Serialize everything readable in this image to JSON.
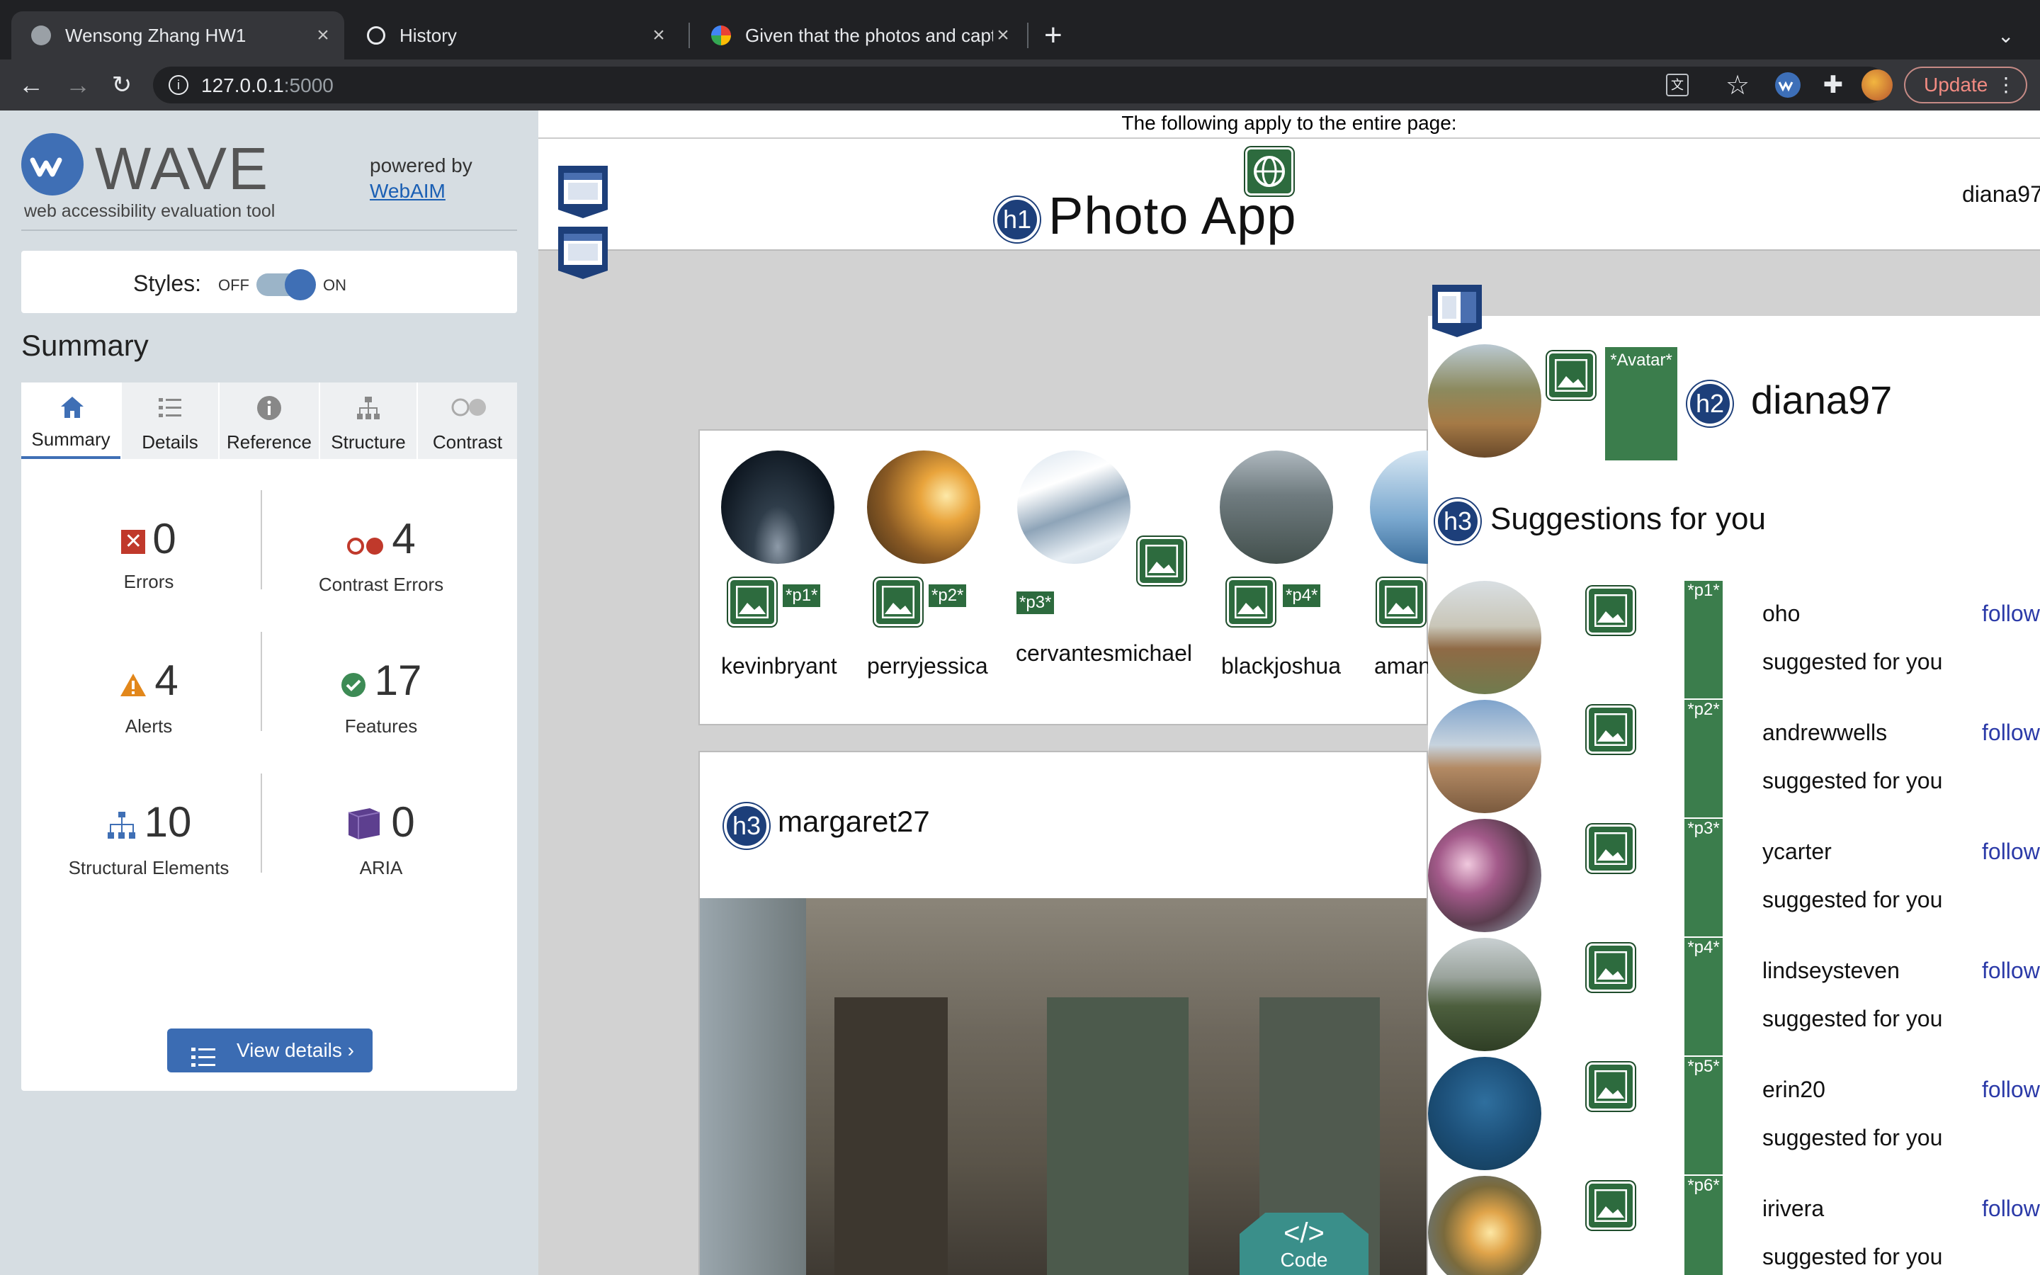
{
  "browser": {
    "tabs": [
      {
        "title": "Wensong Zhang HW1",
        "active": true,
        "icon": "globe-icon"
      },
      {
        "title": "History",
        "active": false,
        "icon": "history-icon"
      },
      {
        "title": "Given that the photos and capt",
        "active": false,
        "icon": "google-icon"
      }
    ],
    "new_tab": "+",
    "address": {
      "host": "127.0.0.1",
      "port": ":5000"
    },
    "update_label": "Update"
  },
  "wave": {
    "logo_text": "WAVE",
    "tagline": "web accessibility evaluation tool",
    "powered_by": "powered by",
    "webaim_link": "WebAIM",
    "styles_label": "Styles:",
    "toggle_off": "OFF",
    "toggle_on": "ON",
    "summary_heading": "Summary",
    "tabs": [
      {
        "label": "Summary",
        "icon": "home-icon",
        "active": true
      },
      {
        "label": "Details",
        "icon": "list-icon",
        "active": false
      },
      {
        "label": "Reference",
        "icon": "info-icon",
        "active": false
      },
      {
        "label": "Structure",
        "icon": "structure-icon",
        "active": false
      },
      {
        "label": "Contrast",
        "icon": "contrast-icon",
        "active": false
      }
    ],
    "stats": {
      "errors": {
        "value": "0",
        "label": "Errors"
      },
      "contrast_errors": {
        "value": "4",
        "label": "Contrast Errors"
      },
      "alerts": {
        "value": "4",
        "label": "Alerts"
      },
      "features": {
        "value": "17",
        "label": "Features"
      },
      "structural": {
        "value": "10",
        "label": "Structural Elements"
      },
      "aria": {
        "value": "0",
        "label": "ARIA"
      }
    },
    "view_details": "View details ›"
  },
  "page": {
    "notice": "The following apply to the entire page:",
    "app_title": "Photo App",
    "header_user": "diana97",
    "h1": "h1",
    "h2": "h2",
    "h3": "h3",
    "stories": [
      {
        "name": "kevinbryant",
        "tag": "*p1*"
      },
      {
        "name": "perryjessica",
        "tag": "*p2*"
      },
      {
        "name": "cervantesmichael",
        "tag": "*p3*"
      },
      {
        "name": "blackjoshua",
        "tag": "*p4*"
      },
      {
        "name": "aman",
        "tag": ""
      }
    ],
    "post_author": "margaret27",
    "profile": {
      "avatar_tag": "*Avatar*",
      "name": "diana97"
    },
    "suggestions_heading": "Suggestions for you",
    "suggestions": [
      {
        "name": "oho",
        "tag": "*p1*",
        "sub": "suggested for you",
        "action": "follow"
      },
      {
        "name": "andrewwells",
        "tag": "*p2*",
        "sub": "suggested for you",
        "action": "follow"
      },
      {
        "name": "ycarter",
        "tag": "*p3*",
        "sub": "suggested for you",
        "action": "follow"
      },
      {
        "name": "lindseysteven",
        "tag": "*p4*",
        "sub": "suggested for you",
        "action": "follow"
      },
      {
        "name": "erin20",
        "tag": "*p5*",
        "sub": "suggested for you",
        "action": "follow"
      },
      {
        "name": "irivera",
        "tag": "*p6*",
        "sub": "suggested for you",
        "action": "follow"
      }
    ],
    "code_toggle": "Code",
    "code_glyph": "</>"
  }
}
